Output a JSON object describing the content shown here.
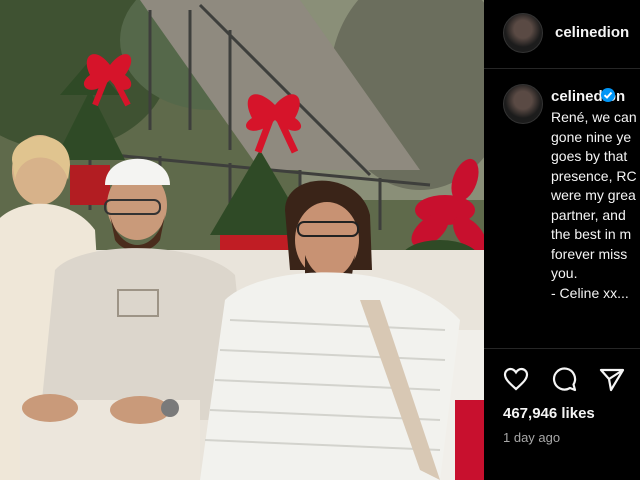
{
  "post": {
    "image_alt": "Family photo on outdoor patio with Christmas bows",
    "image_description_colors": {
      "sky_tree": "#6f7a5c",
      "railing": "#3e3f3c",
      "bow": "#d6142a",
      "sofa": "#f1efea"
    }
  },
  "header": {
    "username": "celinedion"
  },
  "caption": {
    "username": "celinedion",
    "lines": [
      "René, we can",
      "gone nine ye",
      "goes by that",
      "presence, RC",
      "were my grea",
      "partner, and",
      "the best in m",
      "forever miss",
      "you.",
      "- Celine xx..."
    ]
  },
  "actions": {
    "like_icon": "heart-icon",
    "comment_icon": "comment-icon",
    "share_icon": "share-icon"
  },
  "stats": {
    "likes": "467,946 likes",
    "posted": "1 day ago"
  },
  "colors": {
    "accent": "#0095f6",
    "background": "#000000",
    "divider": "#262626"
  }
}
